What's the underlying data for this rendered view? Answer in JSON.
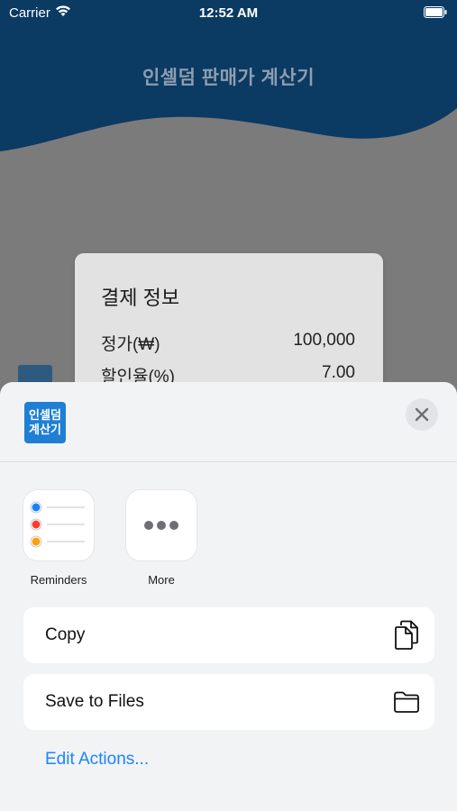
{
  "status_bar": {
    "carrier": "Carrier",
    "time": "12:52 AM"
  },
  "app": {
    "title": "인셀덤 판매가 계산기",
    "card": {
      "title": "결제 정보",
      "rows": [
        {
          "label": "정가(₩)",
          "value": "100,000"
        },
        {
          "label": "할인율(%)",
          "value": "7.00"
        }
      ]
    }
  },
  "share_sheet": {
    "app_icon_text": [
      "인셀덤",
      "계산기"
    ],
    "apps": [
      {
        "label": "Reminders",
        "icon": "reminders-icon"
      },
      {
        "label": "More",
        "icon": "more-icon"
      }
    ],
    "actions": [
      {
        "label": "Copy",
        "icon": "copy-icon"
      },
      {
        "label": "Save to Files",
        "icon": "folder-icon"
      }
    ],
    "edit_actions": "Edit Actions..."
  },
  "colors": {
    "header_blue": "#0b3a63",
    "dim_background": "#7b7b7b",
    "sheet_background": "#f2f3f5",
    "accent_blue": "#1a84ff",
    "app_icon_blue": "#1f7fd4"
  }
}
